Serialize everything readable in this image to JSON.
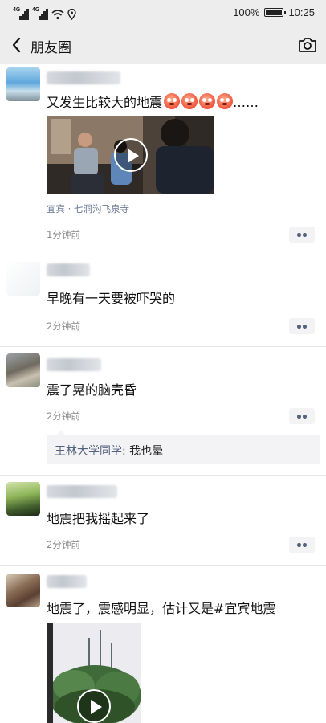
{
  "status_bar": {
    "network_1": "4G",
    "network_2": "4G",
    "battery": "100%",
    "time": "10:25"
  },
  "nav": {
    "title": "朋友圈"
  },
  "posts": [
    {
      "text": "又发生比较大的地震",
      "suffix": "……",
      "location": "宜宾 · 七洞沟飞泉寺",
      "time": "1分钟前"
    },
    {
      "text": "早晚有一天要被吓哭的",
      "time": "2分钟前"
    },
    {
      "text": "震了晃的脑壳昏",
      "time": "2分钟前",
      "comment": {
        "name": "王林大学同学",
        "text": ": 我也晕"
      }
    },
    {
      "text": "地震把我摇起来了",
      "time": "2分钟前"
    },
    {
      "text": "地震了，震感明显，估计又是#宜宾地震"
    }
  ],
  "colors": {
    "bar_bg": "#ededed",
    "link": "#55627e",
    "meta": "#888888"
  }
}
